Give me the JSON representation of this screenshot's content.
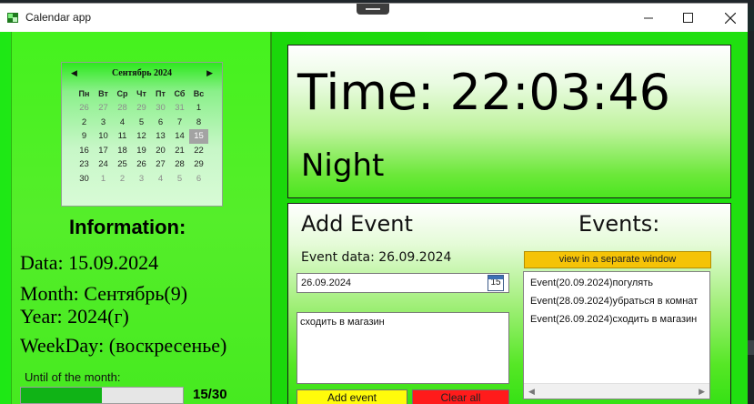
{
  "window": {
    "title": "Calendar app"
  },
  "calendar": {
    "month_label": "Сентябрь 2024",
    "weekdays": [
      "Пн",
      "Вт",
      "Ср",
      "Чт",
      "Пт",
      "Сб",
      "Вс"
    ],
    "days": [
      [
        "26",
        "27",
        "28",
        "29",
        "30",
        "31",
        "1"
      ],
      [
        "2",
        "3",
        "4",
        "5",
        "6",
        "7",
        "8"
      ],
      [
        "9",
        "10",
        "11",
        "12",
        "13",
        "14",
        "15"
      ],
      [
        "16",
        "17",
        "18",
        "19",
        "20",
        "21",
        "22"
      ],
      [
        "23",
        "24",
        "25",
        "26",
        "27",
        "28",
        "29"
      ],
      [
        "30",
        "1",
        "2",
        "3",
        "4",
        "5",
        "6"
      ]
    ],
    "selected_day": "15"
  },
  "info": {
    "title": "Information:",
    "data_line": "Data: 15.09.2024",
    "month_line": "Month: Сентябрь(9)",
    "year_line": "Year: 2024(г)",
    "weekday_line": "WeekDay: (воскресенье)"
  },
  "progress": {
    "label": "Until of the month:",
    "value_text": "15/30",
    "fraction": 0.5
  },
  "clock": {
    "time": "Time: 22:03:46",
    "day_part": "Night"
  },
  "add_event": {
    "title": "Add Event",
    "event_data_label": "Event data: 26.09.2024",
    "date_value": "26.09.2024",
    "calendar_icon_day": "15",
    "text_value": "сходить в магазин",
    "add_button": "Add event",
    "clear_button": "Clear all"
  },
  "events": {
    "title": "Events:",
    "view_button": "view in a separate window",
    "items": [
      "Event(20.09.2024)погулять",
      "Event(28.09.2024)убраться в комнат",
      "Event(26.09.2024)сходить в магазин"
    ]
  },
  "colors": {
    "main_green": "#2fe80f",
    "add_button": "#fffb0b",
    "clear_button": "#ff1b1b",
    "view_button": "#f5c307",
    "progress_fill": "#10b316"
  }
}
